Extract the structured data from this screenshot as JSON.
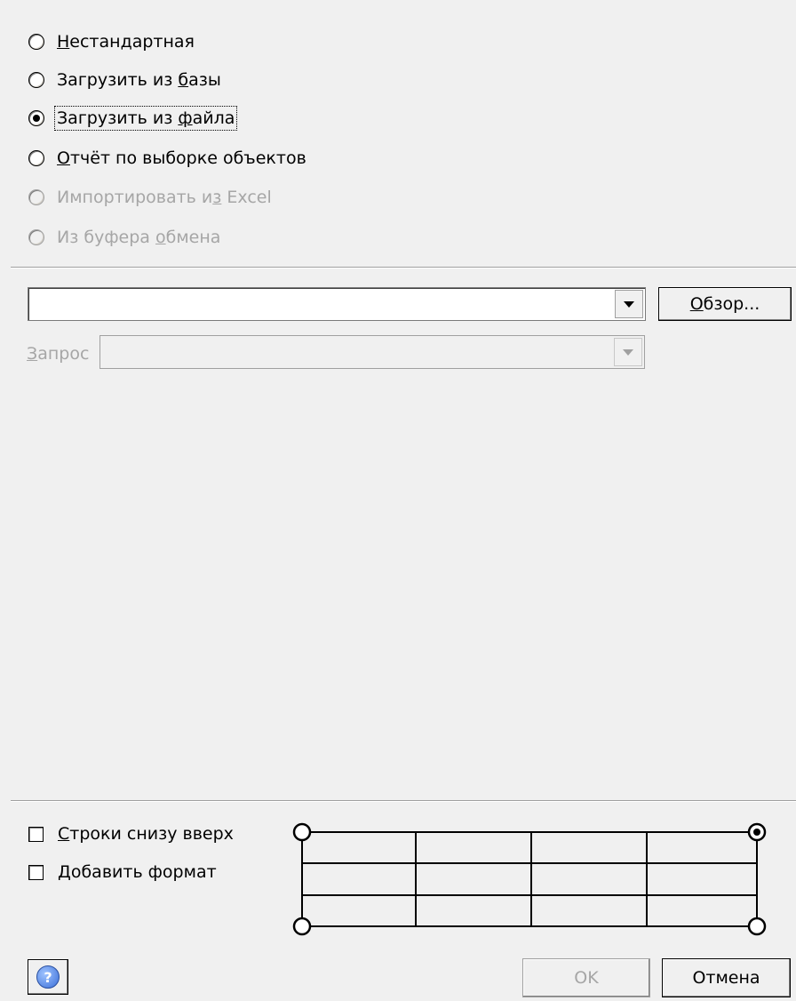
{
  "source_options": [
    {
      "label_pre": "",
      "label_u": "Н",
      "label_post": "естандартная",
      "checked": false,
      "disabled": false
    },
    {
      "label_pre": "Загрузить из ",
      "label_u": "б",
      "label_post": "азы",
      "checked": false,
      "disabled": false
    },
    {
      "label_pre": "Загрузить из ",
      "label_u": "ф",
      "label_post": "айла",
      "checked": true,
      "disabled": false
    },
    {
      "label_pre": "",
      "label_u": "О",
      "label_post": "тчёт по выборке объектов",
      "checked": false,
      "disabled": false
    },
    {
      "label_pre": "Импортировать и",
      "label_u": "з",
      "label_post": " Excel",
      "checked": false,
      "disabled": true
    },
    {
      "label_pre": "Из буфера ",
      "label_u": "о",
      "label_post": "бмена",
      "checked": false,
      "disabled": true
    }
  ],
  "file": {
    "value": "",
    "browse_u": "О",
    "browse_rest": "бзор..."
  },
  "query": {
    "label_u": "З",
    "label_rest": "апрос",
    "value": ""
  },
  "options": {
    "rows_bottom_up": {
      "label_u": "С",
      "label_rest": "троки снизу вверх",
      "checked": false
    },
    "add_format": {
      "label_u": "Д",
      "label_rest": "обавить формат",
      "checked": false
    }
  },
  "corner_selected": "top-right",
  "buttons": {
    "help": "?",
    "ok": "OK",
    "cancel": "Отмена"
  },
  "colors": {
    "background": "#f0f0f0",
    "disabled_text": "#a6a6a6",
    "help_icon": "#3a6fd8"
  }
}
